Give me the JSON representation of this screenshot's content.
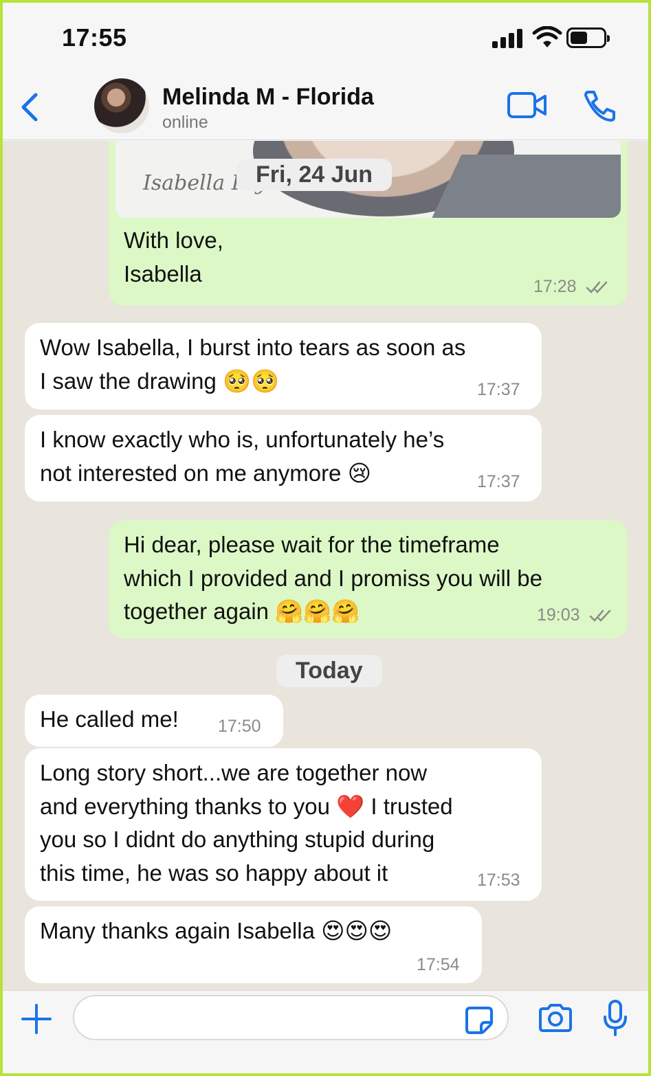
{
  "status": {
    "time": "17:55"
  },
  "header": {
    "name": "Melinda M - Florida",
    "status": "online"
  },
  "attachment": {
    "signature": "Isabella Psy.",
    "caption_line1": "With love,",
    "caption_line2": "Isabella",
    "time": "17:28"
  },
  "date_sep_1": "Fri, 24 Jun",
  "messages": [
    {
      "line1": "Wow Isabella, I burst into tears as soon as",
      "line2": "I saw the drawing 🥺🥺",
      "time": "17:37"
    },
    {
      "line1": "I know exactly who is, unfortunately he’s",
      "line2": "not interested on me anymore 😢",
      "time": "17:37"
    },
    {
      "line1": "Hi dear, please wait for the timeframe",
      "line2": "which I provided and I promiss you will be",
      "line3": "together again 🤗🤗🤗",
      "time": "19:03"
    }
  ],
  "date_sep_2": "Today",
  "today_messages": [
    {
      "line1": "He called me!",
      "time": "17:50"
    },
    {
      "line1": "Long story short...we are together now",
      "line2": "and everything thanks to you ❤️ I trusted",
      "line3": "you so I didnt do anything stupid during",
      "line4": "this time, he was so happy about it",
      "time": "17:53"
    },
    {
      "line1": "Many thanks again Isabella 😍😍😍",
      "time": "17:54"
    }
  ],
  "colors": {
    "accent": "#1a73e8",
    "outgoing": "#dcf8c6",
    "incoming": "#ffffff",
    "chat_bg": "#e9e4dc",
    "frame": "#b7e23a"
  },
  "icons": [
    "chevron-left-icon",
    "video-call-icon",
    "phone-icon",
    "plus-icon",
    "sticker-icon",
    "camera-icon",
    "mic-icon",
    "double-check-icon"
  ]
}
